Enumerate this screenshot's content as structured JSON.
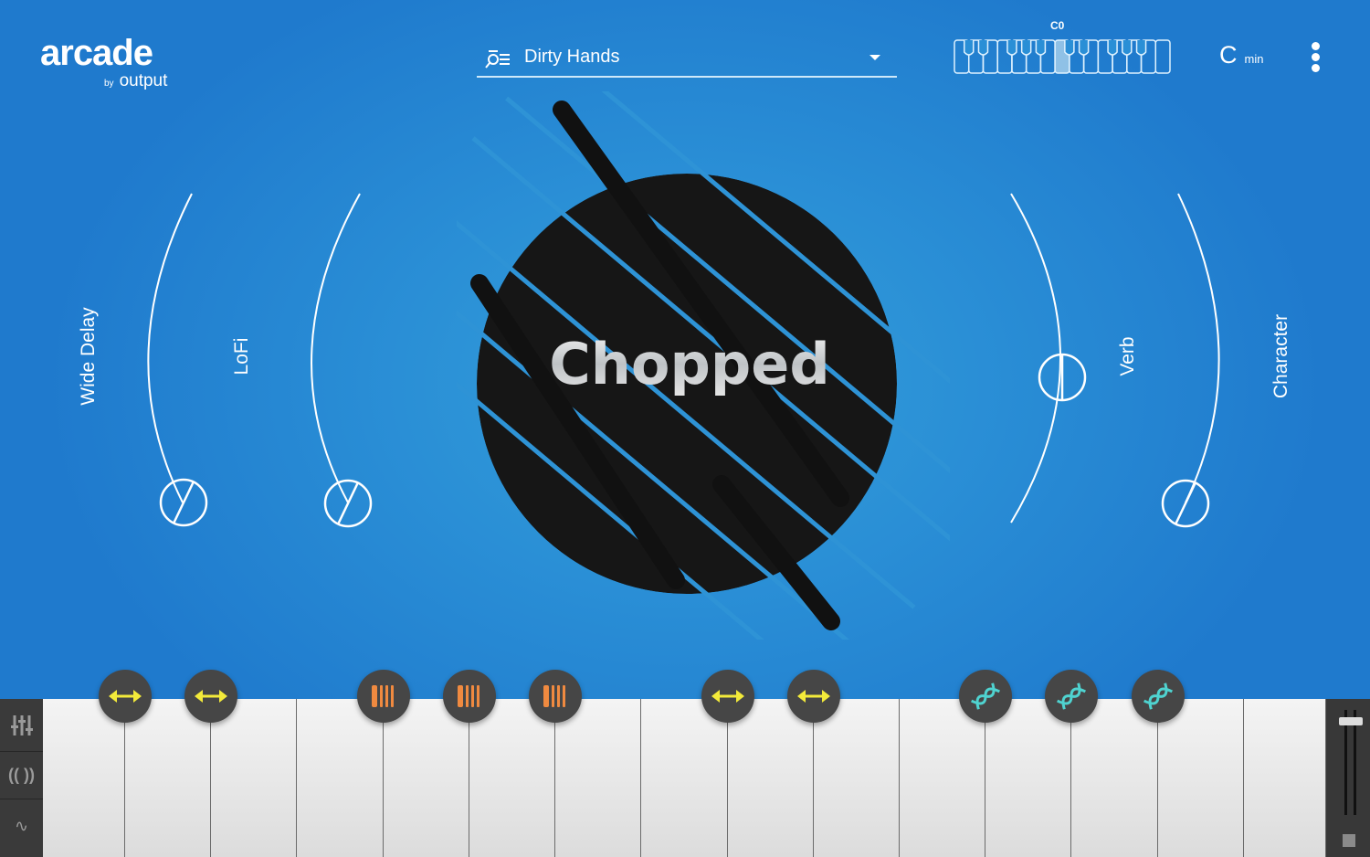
{
  "app": {
    "logo": "arcade",
    "logo_by": "by",
    "logo_brand": "output"
  },
  "header": {
    "preset_name": "Dirty Hands",
    "preset_icon": "preset-browser-icon",
    "key_range_label": "C0",
    "key_root": "C",
    "key_mode": "min",
    "menu_icon": "kebab-menu-icon"
  },
  "knobs": [
    {
      "label": "Wide Delay",
      "value": 0.0
    },
    {
      "label": "LoFi",
      "value": 0.0
    },
    {
      "label": "Verb",
      "value": 0.5
    },
    {
      "label": "Character",
      "value": 0.0
    }
  ],
  "center": {
    "title": "Chopped"
  },
  "badges": [
    {
      "icon": "arrows-horizontal-icon",
      "color": "#f3ea3a"
    },
    {
      "icon": "arrows-horizontal-icon",
      "color": "#f3ea3a"
    },
    {
      "icon": "bars-icon",
      "color": "#f08a40"
    },
    {
      "icon": "bars-icon",
      "color": "#f08a40"
    },
    {
      "icon": "bars-icon",
      "color": "#f08a40"
    },
    {
      "icon": "arrows-horizontal-icon",
      "color": "#f3ea3a"
    },
    {
      "icon": "arrows-horizontal-icon",
      "color": "#f3ea3a"
    },
    {
      "icon": "dna-icon",
      "color": "#4fd3d0"
    },
    {
      "icon": "dna-icon",
      "color": "#4fd3d0"
    },
    {
      "icon": "dna-icon",
      "color": "#4fd3d0"
    }
  ],
  "sidebar": {
    "items": [
      {
        "icon": "mixer-icon"
      },
      {
        "icon": "stereo-icon"
      },
      {
        "icon": "lfo-wave-icon"
      }
    ]
  },
  "volume": {
    "level": 0.92
  },
  "colors": {
    "background": "#2a8fd6",
    "keys": "#ececec",
    "panel": "#2c2c2c"
  }
}
